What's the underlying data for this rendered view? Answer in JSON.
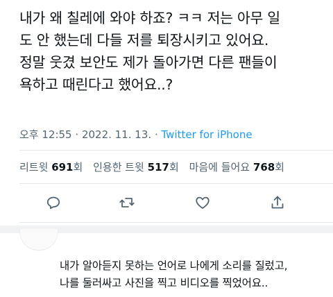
{
  "tweet": {
    "text": "내가 왜 칠레에 와야 하죠? ㅋㅋ 저는 아무 일\n도 안 했는데 다들 저를 퇴장시키고 있어요.\n정말 웃겼 보안도 제가 돌아가면 다른 팬들이\n욕하고 때린다고 했어요..?",
    "time": "오후 12:55",
    "separator": "·",
    "date": "2022. 11. 13.",
    "source": "Twitter for iPhone"
  },
  "stats": {
    "retweets_label": "리트윗",
    "retweets_count": "691",
    "retweets_unit": "회",
    "quotes_label": "인용한 트윗",
    "quotes_count": "517",
    "quotes_unit": "회",
    "likes_label": "마음에 들어요",
    "likes_count": "768",
    "likes_unit": "회"
  },
  "actions": {
    "reply_icon": "comment-icon",
    "retweet_icon": "retweet-icon",
    "like_icon": "heart-icon",
    "share_icon": "share-icon",
    "icon_color": "#536471"
  },
  "reply": {
    "text": "내가 알아듣지 못하는 언어로 나에게 소리를 질렀고,\n나를 둘러싸고 사진을 찍고 비디오를 찍었어요.."
  },
  "colors": {
    "text": "#0f1419",
    "secondary": "#536471",
    "link": "#1d9bf0",
    "divider": "#e6e9eb"
  }
}
